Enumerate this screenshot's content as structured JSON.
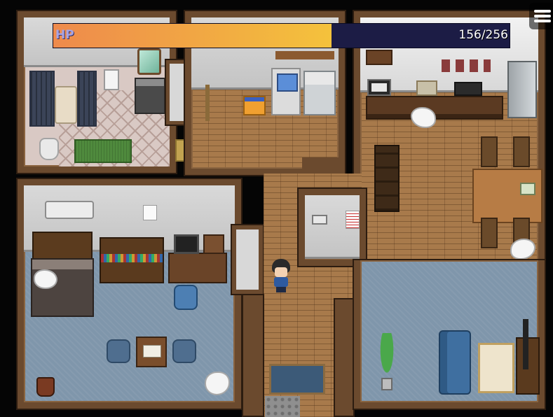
{
  "hud": {
    "hp_label": "HP",
    "hp_current": 156,
    "hp_max": 256,
    "hp_text": "156/256",
    "hp_fraction": 0.609,
    "bar_colors": {
      "fill_start": "#ee8a4c",
      "fill_end": "#f4c23c",
      "empty": "#1c1c45"
    }
  },
  "menu": {
    "icon": "hamburger-menu-icon"
  },
  "map": {
    "rooms": [
      "bathroom",
      "laundry-corridor",
      "kitchen-dining",
      "bedroom",
      "hallway",
      "storage-room",
      "living-room"
    ],
    "player": {
      "facing": "down",
      "hair": "black",
      "outfit": "blue"
    },
    "colors": {
      "wall_trim": "#6b4a2e",
      "wood_floor": "#a87a4b",
      "blue_carpet": "#7f96ab",
      "wall_face": "#d9d9d9"
    }
  }
}
